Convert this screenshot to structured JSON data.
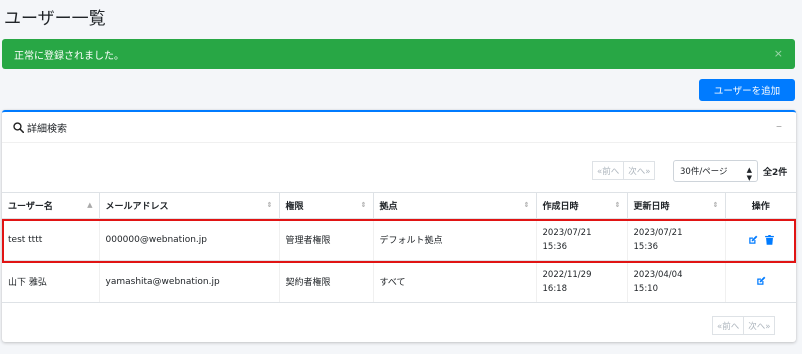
{
  "page": {
    "title": "ユーザー一覧"
  },
  "alert": {
    "message": "正常に登録されました。",
    "close": "×",
    "color": "#28a745"
  },
  "toolbar": {
    "add_user_label": "ユーザーを追加"
  },
  "search": {
    "title": "詳細検索",
    "collapse": "–"
  },
  "pagination": {
    "prev": "«前へ",
    "next": "次へ»",
    "per_page": "30件/ページ",
    "total": "全2件"
  },
  "table": {
    "headers": {
      "name": "ユーザー名",
      "email": "メールアドレス",
      "role": "権限",
      "base": "拠点",
      "created": "作成日時",
      "updated": "更新日時",
      "actions": "操作"
    },
    "rows": [
      {
        "name": "test tttt",
        "email": "000000@webnation.jp",
        "role": "管理者権限",
        "base": "デフォルト拠点",
        "created_date": "2023/07/21",
        "created_time": "15:36",
        "updated_date": "2023/07/21",
        "updated_time": "15:36"
      },
      {
        "name": "山下 雅弘",
        "email": "yamashita@webnation.jp",
        "role": "契約者権限",
        "base": "すべて",
        "created_date": "2022/11/29",
        "created_time": "16:18",
        "updated_date": "2023/04/04",
        "updated_time": "15:10"
      }
    ]
  },
  "colors": {
    "primary": "#007bff",
    "highlight": "#e11414"
  },
  "icons": {
    "search": "search-icon",
    "edit": "edit-icon",
    "delete": "trash-icon"
  }
}
